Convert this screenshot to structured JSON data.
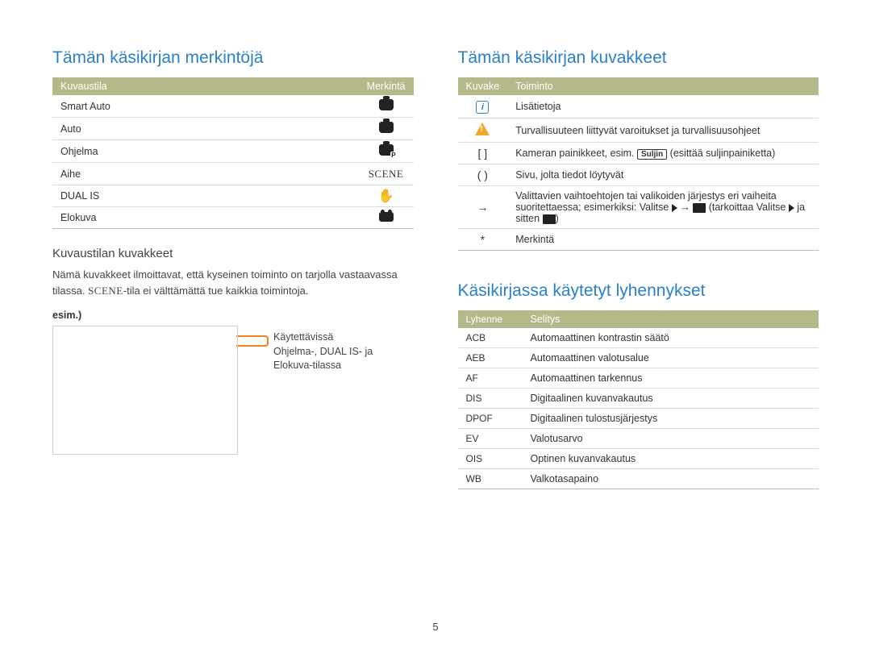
{
  "page_number": "5",
  "left": {
    "heading": "Tämän käsikirjan merkintöjä",
    "table1": {
      "head": [
        "Kuvaustila",
        "Merkintä"
      ],
      "rows": [
        {
          "mode": "Smart Auto",
          "icon": "camera-smart"
        },
        {
          "mode": "Auto",
          "icon": "camera"
        },
        {
          "mode": "Ohjelma",
          "icon": "camera-p"
        },
        {
          "mode": "Aihe",
          "icon": "scene"
        },
        {
          "mode": "DUAL IS",
          "icon": "hand"
        },
        {
          "mode": "Elokuva",
          "icon": "film"
        }
      ]
    },
    "sub_heading": "Kuvaustilan kuvakkeet",
    "desc_part1": "Nämä kuvakkeet ilmoittavat, että kyseinen toiminto on tarjolla vastaavassa tilassa. ",
    "desc_part2": "-tila ei välttämättä tue kaikkia toimintoja.",
    "esim_label": "esim.)",
    "callout_line1": "Käytettävissä",
    "callout_line2": "Ohjelma-, DUAL IS- ja",
    "callout_line3": "Elokuva-tilassa"
  },
  "right_top": {
    "heading": "Tämän käsikirjan kuvakkeet",
    "table": {
      "head": [
        "Kuvake",
        "Toiminto"
      ],
      "rows": [
        {
          "icon": "note",
          "text": "Lisätietoja"
        },
        {
          "icon": "warn",
          "text": "Turvallisuuteen liittyvät varoitukset ja turvallisuusohjeet"
        },
        {
          "icon": "[  ]",
          "pretext": "Kameran painikkeet, esim. ",
          "btn": "Suljin",
          "posttext": " (esittää suljinpainiketta)"
        },
        {
          "icon": "(  )",
          "text": "Sivu, jolta tiedot löytyvät"
        },
        {
          "icon": "→",
          "pretext": "Valittavien vaihtoehtojen tai valikoiden järjestys eri vaiheita suoritettaessa; esimerkiksi: Valitse ",
          "posttext1": " → ",
          "posttext2": " (tarkoittaa Valitse ",
          "posttext3": " ja sitten ",
          "posttext4": ")"
        },
        {
          "icon": "*",
          "text": "Merkintä"
        }
      ]
    }
  },
  "right_bottom": {
    "heading": "Käsikirjassa käytetyt lyhennykset",
    "table": {
      "head": [
        "Lyhenne",
        "Selitys"
      ],
      "rows": [
        {
          "abbr": "ACB",
          "text": "Automaattinen kontrastin säätö"
        },
        {
          "abbr": "AEB",
          "text": "Automaattinen valotusalue"
        },
        {
          "abbr": "AF",
          "text": "Automaattinen tarkennus"
        },
        {
          "abbr": "DIS",
          "text": "Digitaalinen kuvanvakautus"
        },
        {
          "abbr": "DPOF",
          "text": "Digitaalinen tulostusjärjestys"
        },
        {
          "abbr": "EV",
          "text": "Valotusarvo"
        },
        {
          "abbr": "OIS",
          "text": "Optinen kuvanvakautus"
        },
        {
          "abbr": "WB",
          "text": "Valkotasapaino"
        }
      ]
    }
  }
}
